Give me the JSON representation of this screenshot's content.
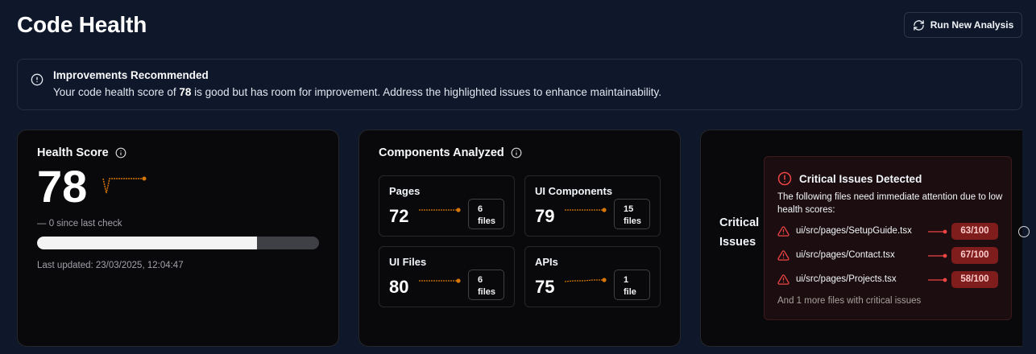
{
  "header": {
    "title": "Code Health",
    "run_button_label": "Run New Analysis"
  },
  "alert": {
    "title": "Improvements Recommended",
    "desc_before": "Your code health score of ",
    "desc_score": "78",
    "desc_after": " is good but has room for improvement. Address the highlighted issues to enhance maintainability."
  },
  "health": {
    "title": "Health Score",
    "score": "78",
    "progress_fraction": 0.78,
    "since": "— 0 since last check",
    "updated": "Last updated: 23/03/2025, 12:04:47"
  },
  "components": {
    "title": "Components Analyzed",
    "items": [
      {
        "label": "Pages",
        "value": "72",
        "count": "6",
        "unit": "files"
      },
      {
        "label": "UI Components",
        "value": "79",
        "count": "15",
        "unit": "files"
      },
      {
        "label": "UI Files",
        "value": "80",
        "count": "6",
        "unit": "files"
      },
      {
        "label": "APIs",
        "value": "75",
        "count": "1",
        "unit": "file"
      }
    ]
  },
  "critical": {
    "label_line1": "Critical",
    "label_line2": "Issues",
    "box_title": "Critical Issues Detected",
    "box_desc": "The following files need immediate attention due to low health scores:",
    "files": [
      {
        "path": "ui/src/pages/SetupGuide.tsx",
        "score": "63/100"
      },
      {
        "path": "ui/src/pages/Contact.tsx",
        "score": "67/100"
      },
      {
        "path": "ui/src/pages/Projects.tsx",
        "score": "58/100"
      }
    ],
    "more": "And 1 more files with critical issues"
  },
  "colors": {
    "background": "#0f172a",
    "card": "#09090b",
    "spark_amber": "#d97706",
    "critical_red": "#ef4444",
    "score_badge": "#7f1d1d"
  },
  "icons": [
    "refresh-icon",
    "info-circle-icon",
    "alert-triangle-icon",
    "alert-circle-icon"
  ]
}
